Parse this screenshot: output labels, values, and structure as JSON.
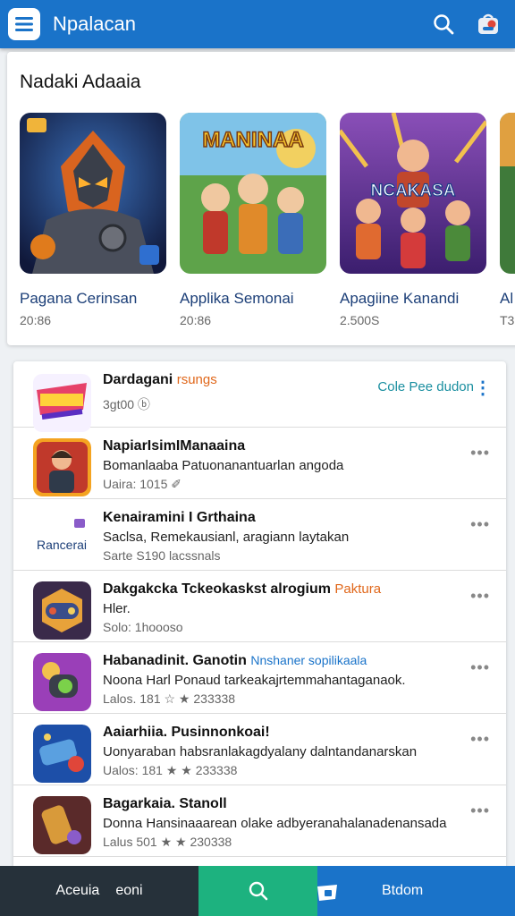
{
  "app": {
    "title": "Npalacan"
  },
  "featured": {
    "title": "Nadaki Adaaia",
    "cards": [
      {
        "name": "Pagana Cerinsan",
        "meta": "20:86",
        "badge": ""
      },
      {
        "name": "Applika Semonai",
        "meta": "20:86",
        "badge": "MANINAA"
      },
      {
        "name": "Apagiine Kanandi",
        "meta": "2.500S",
        "badge": "NCAKASA"
      },
      {
        "name": "Al",
        "meta": "T3",
        "badge": ""
      }
    ]
  },
  "list": {
    "first": {
      "title": "Dardagani",
      "tag": "rsungs",
      "meta": "3ɡt00 ⓑ",
      "action": "Cole Pee dudon"
    },
    "items": [
      {
        "title": "NapiarIsimIManaaina",
        "tag": "",
        "sub": "Bomanlaaba Patuonanantuarlan angoda",
        "meta": "Uaira:  1015 ✐"
      },
      {
        "title": "Kenairamini I Grthaina",
        "tag": "",
        "sub": "Saclsa, Remekausianl, aragiann laytakan",
        "meta": "Sarte   S190 lacssnals"
      },
      {
        "title": "Dakgakcka  Tckeokaskst alrogium",
        "tag": "Paktura",
        "sub": "Hler.",
        "meta": "Solo:  1hoooso"
      },
      {
        "title": "Habanadinit. Ganotin",
        "tag": "Nnshaner sopilikaala",
        "sub": "Noona Harl  Ponaud tarkeakajrtemmahantaganaok.",
        "meta": "Lalos.  181 ☆ ★ 233338"
      },
      {
        "title": "Aaiarhiia. Pusinnonkoai!",
        "tag": "",
        "sub": "Uonyaraban habsranlakagdyalany dalntandanarskan",
        "meta": "Ualos:  181 ★ ★ 233338"
      },
      {
        "title": "Bagarkaia. Stanoll",
        "tag": "",
        "sub": "Donna Hansinaaarean olake adbyeranahalanadenansada",
        "meta": "Lalus  501 ★ ★ 230338"
      }
    ]
  },
  "nav": {
    "left_label": "Aceuia",
    "left_label2": "eoni",
    "right_label": "Btdom"
  },
  "colors": {
    "appbar": "#1a73c9",
    "nav_dark": "#26313a",
    "nav_green": "#1db27f"
  }
}
